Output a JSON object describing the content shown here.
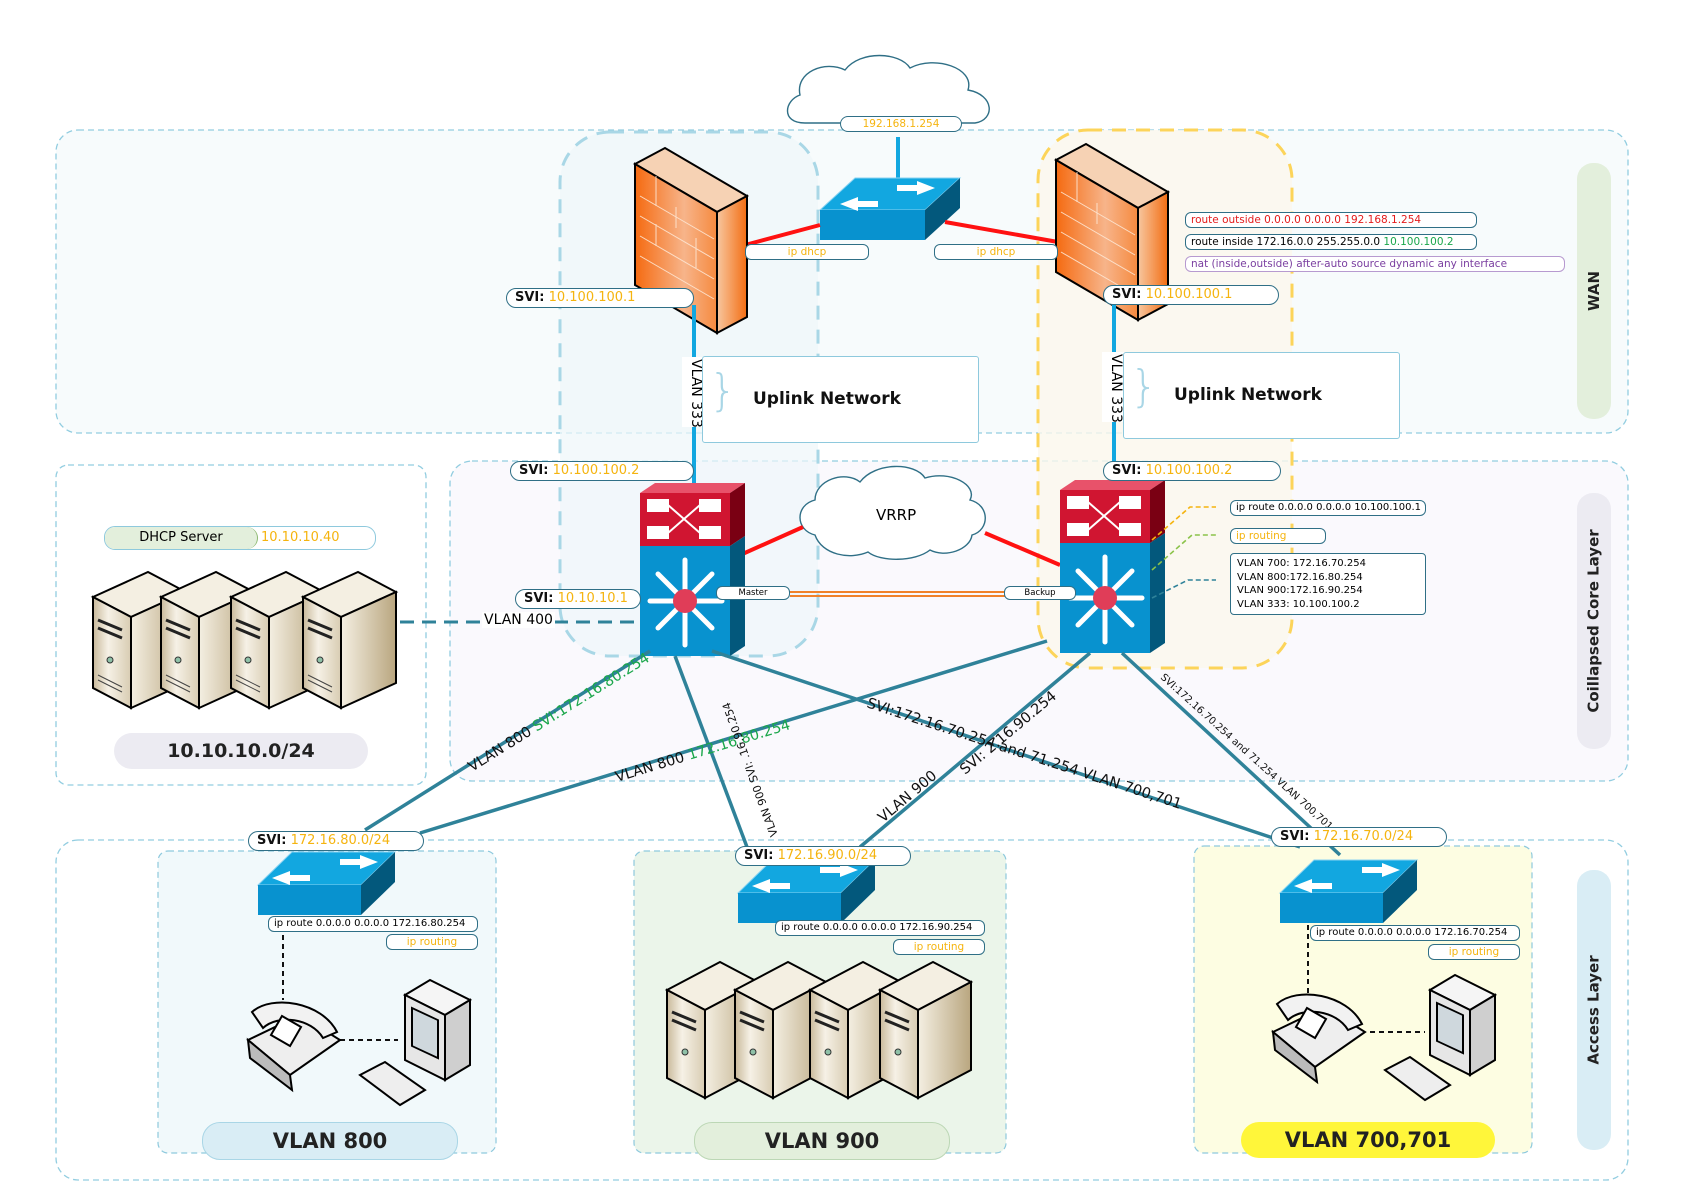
{
  "diagram": {
    "layers": [
      {
        "id": "wan",
        "label": "WAN"
      },
      {
        "id": "core",
        "label": "Coillapsed Core Layer"
      },
      {
        "id": "access",
        "label": "Access Layer"
      }
    ],
    "internet_cloud": {
      "gateway_ip": "192.168.1.254"
    },
    "wan": {
      "firewall_left": {
        "dhcp_label": "ip dhcp",
        "svi_prefix": "SVI:",
        "svi_ip": "10.100.100.1"
      },
      "firewall_right": {
        "dhcp_label": "ip dhcp",
        "svi_prefix": "SVI:",
        "svi_ip": "10.100.100.1"
      },
      "firewall_config": [
        {
          "prefix": "route outside 0.0.0.0 0.0.0.0 ",
          "value": "192.168.1.254",
          "color": "#e41c1c"
        },
        {
          "prefix": "route inside 172.16.0.0 255.255.0.0 ",
          "value": "10.100.100.2",
          "color": "#1aa64a"
        },
        {
          "prefix": "nat (inside,outside) after-auto source dynamic any interface",
          "value": "",
          "color": "#7a3ea0"
        }
      ],
      "uplink_left": {
        "vlan": "VLAN 333",
        "title": "Uplink Network"
      },
      "uplink_right": {
        "vlan": "VLAN 333",
        "title": "Uplink Network"
      }
    },
    "core": {
      "left_switch": {
        "svi_prefix": "SVI:",
        "uplink_svi": "10.100.100.2",
        "vlan400_svi": "10.10.10.1",
        "role": "Master"
      },
      "right_switch": {
        "svi_prefix": "SVI:",
        "uplink_svi": "10.100.100.2",
        "role": "Backup"
      },
      "vrrp_label": "VRRP",
      "right_config": {
        "ip_route": "ip route 0.0.0.0 0.0.0.0 10.100.100.1",
        "ip_routing": "ip routing",
        "vlans": [
          "VLAN 700: 172.16.70.254",
          "VLAN 800:172.16.80.254",
          "VLAN 900:172.16.90.254",
          "VLAN 333: 10.100.100.2"
        ]
      },
      "dhcp_server": {
        "label": "DHCP Server",
        "ip": "10.10.10.40",
        "subnet": "10.10.10.0/24",
        "link_label": "VLAN 400"
      }
    },
    "links": {
      "left_to_vlan800": {
        "prefix": "VLAN 800 ",
        "svi": "SVI:172.16.80.254"
      },
      "right_to_vlan800": {
        "prefix": "VLAN 800 ",
        "svi": "172.16.80.254"
      },
      "left_to_vlan900": "VLAN 900 SVI: .16.90.254",
      "right_to_vlan900": "VLAN 900",
      "right_to_vlan900_b": "SVI: 2.16.90.254",
      "left_to_vlan700": "SVI:172.16.70.254 and  71.254 VLAN 700,701",
      "right_to_vlan700": "SVI:172.16.70.254 and  71.254 VLAN 700,701"
    },
    "access": [
      {
        "name": "VLAN 800",
        "svi_prefix": "SVI:",
        "svi": "172.16.80.0/24",
        "ip_route": "ip route 0.0.0.0 0.0.0.0 172.16.80.254",
        "ip_routing": "ip routing",
        "badge_color": "#d9edf5"
      },
      {
        "name": "VLAN 900",
        "svi_prefix": "SVI:",
        "svi": "172.16.90.0/24",
        "ip_route": "ip route 0.0.0.0 0.0.0.0 172.16.90.254",
        "ip_routing": "ip routing",
        "badge_color": "#e3efdc"
      },
      {
        "name": "VLAN 700,701",
        "svi_prefix": "SVI:",
        "svi": "172.16.70.0/24",
        "ip_route": "ip route 0.0.0.0 0.0.0.0 172.16.70.254",
        "ip_routing": "ip routing",
        "badge_color": "#fff63a"
      }
    ],
    "colors": {
      "accent_yellow": "#f5b40f",
      "link_teal": "#2f8299",
      "link_red": "#ff0000",
      "uplink_blue": "#12a7e0",
      "firewall_orange": "#f97a1f",
      "switch_blue": "#0892cf",
      "router_red": "#d01531"
    }
  }
}
